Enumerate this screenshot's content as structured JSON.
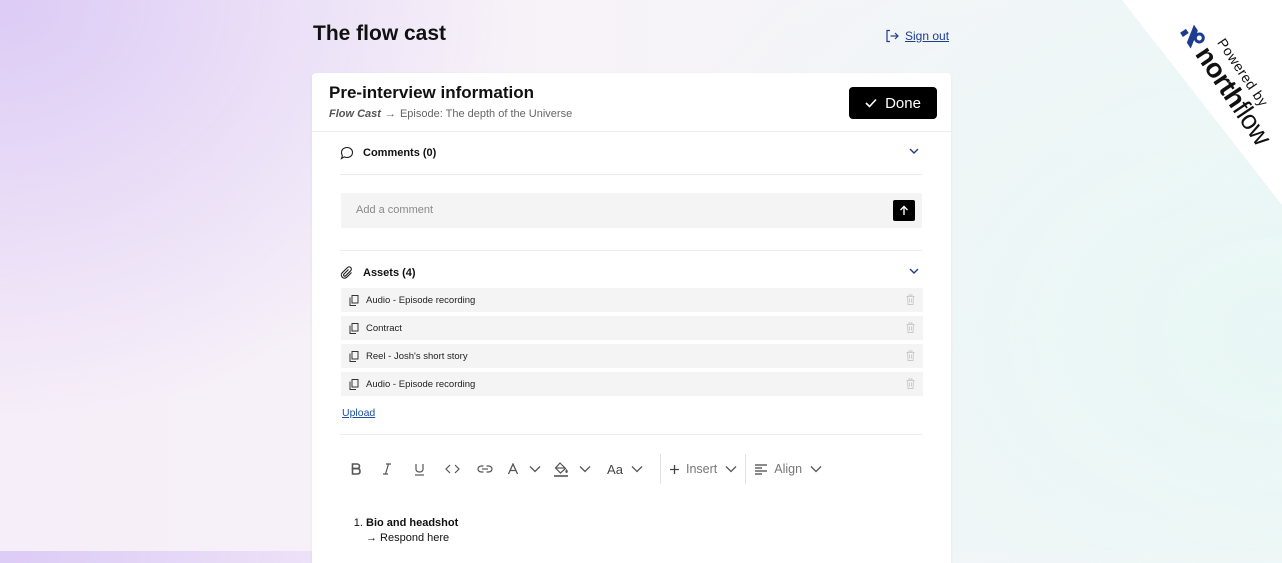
{
  "app": {
    "title": "The flow cast",
    "sign_out": "Sign out"
  },
  "branding": {
    "powered_by": "Powered by",
    "brand_bold": "north",
    "brand_light": "flow",
    "brand_color": "#1d3d8f"
  },
  "card": {
    "title": "Pre-interview information",
    "breadcrumb_show": "Flow Cast",
    "breadcrumb_arrow": "→",
    "breadcrumb_episode": "Episode: The depth of the Universe",
    "done_label": "Done"
  },
  "comments": {
    "header": "Comments (0)",
    "placeholder": "Add a comment"
  },
  "assets": {
    "header": "Assets (4)",
    "items": [
      {
        "label": "Audio - Episode recording"
      },
      {
        "label": "Contract"
      },
      {
        "label": "Reel - Josh's short story"
      },
      {
        "label": "Audio - Episode recording"
      }
    ],
    "upload_label": "Upload"
  },
  "toolbar": {
    "font_size_label": "Aa",
    "insert_label": "Insert",
    "align_label": "Align"
  },
  "editor": {
    "item1_title": "Bio and headshot",
    "item1_response": "→ Respond here"
  }
}
